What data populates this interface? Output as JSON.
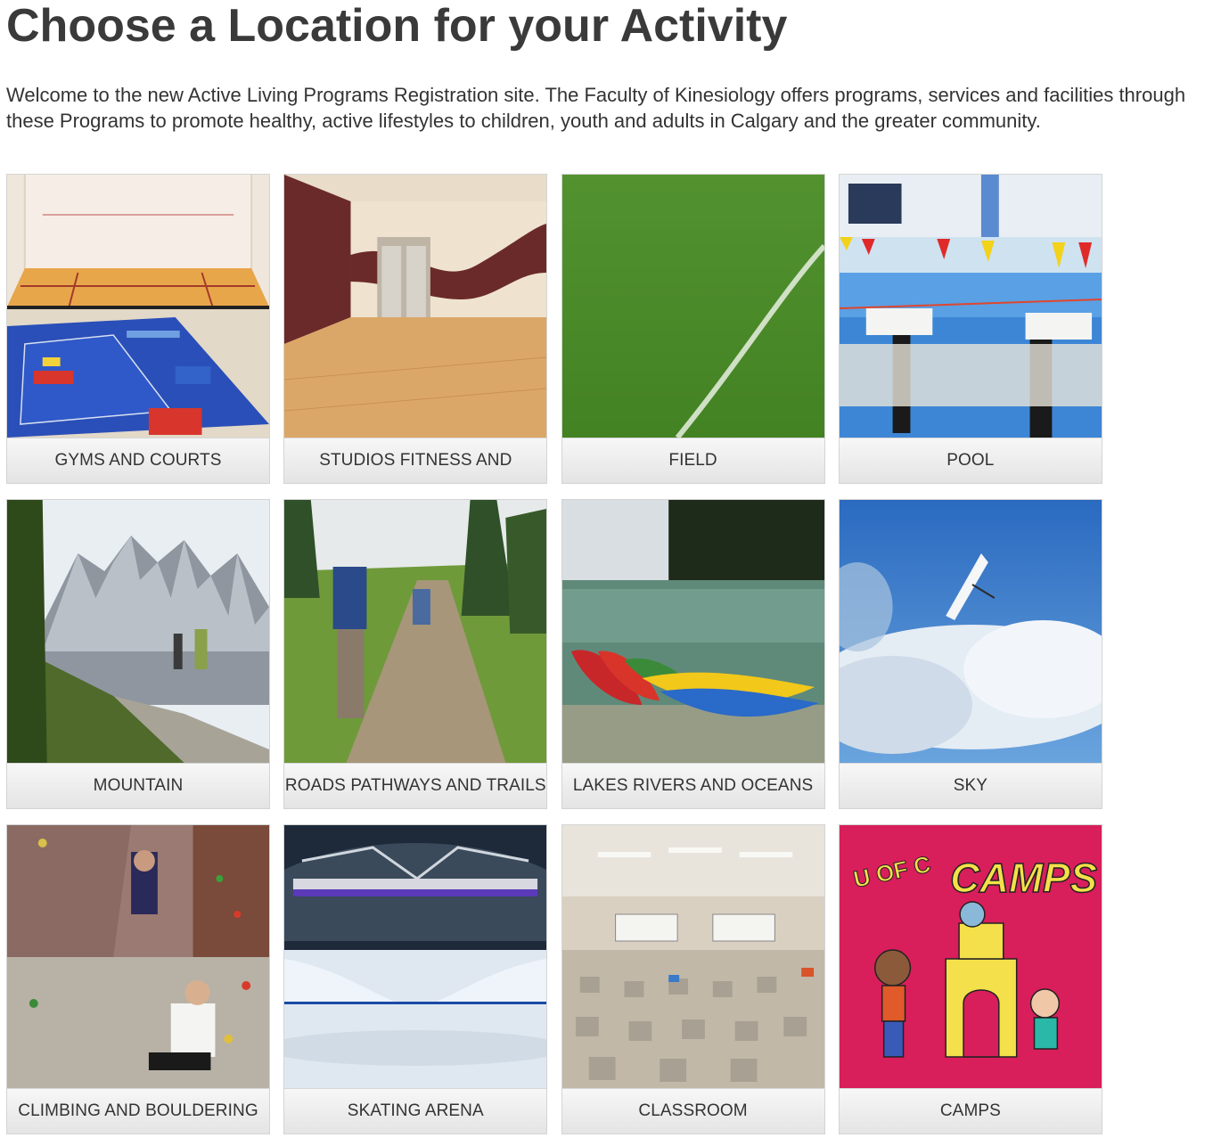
{
  "page": {
    "title": "Choose a Location for your Activity",
    "intro": "Welcome to the new Active Living Programs Registration site. The Faculty of Kinesiology offers programs, services and facilities through these Programs to promote healthy, active lifestyles to children, youth and adults in Calgary and the greater community."
  },
  "locations": [
    {
      "label": "GYMS AND COURTS",
      "image": "gym-court-photo"
    },
    {
      "label": "STUDIOS FITNESS AND",
      "image": "studio-photo"
    },
    {
      "label": "FIELD",
      "image": "field-photo"
    },
    {
      "label": "POOL",
      "image": "pool-photo"
    },
    {
      "label": "MOUNTAIN",
      "image": "mountain-photo"
    },
    {
      "label": "ROADS PATHWAYS AND TRAILS",
      "image": "trail-photo"
    },
    {
      "label": "LAKES RIVERS AND OCEANS",
      "image": "kayaks-photo"
    },
    {
      "label": "SKY",
      "image": "sky-photo"
    },
    {
      "label": "CLIMBING AND BOULDERING",
      "image": "climbing-photo"
    },
    {
      "label": "SKATING ARENA",
      "image": "skating-arena-photo"
    },
    {
      "label": "CLASSROOM",
      "image": "classroom-photo"
    },
    {
      "label": "CAMPS",
      "image": "camps-photo",
      "logo_text": "U OF C CAMPS"
    }
  ],
  "colors": {
    "title": "#3a3a3a",
    "text": "#333333",
    "tile_border": "#d4d4d4",
    "label_bg_top": "#f7f7f7",
    "label_bg_bottom": "#e4e4e4",
    "camps_bg": "#d81e5b"
  }
}
